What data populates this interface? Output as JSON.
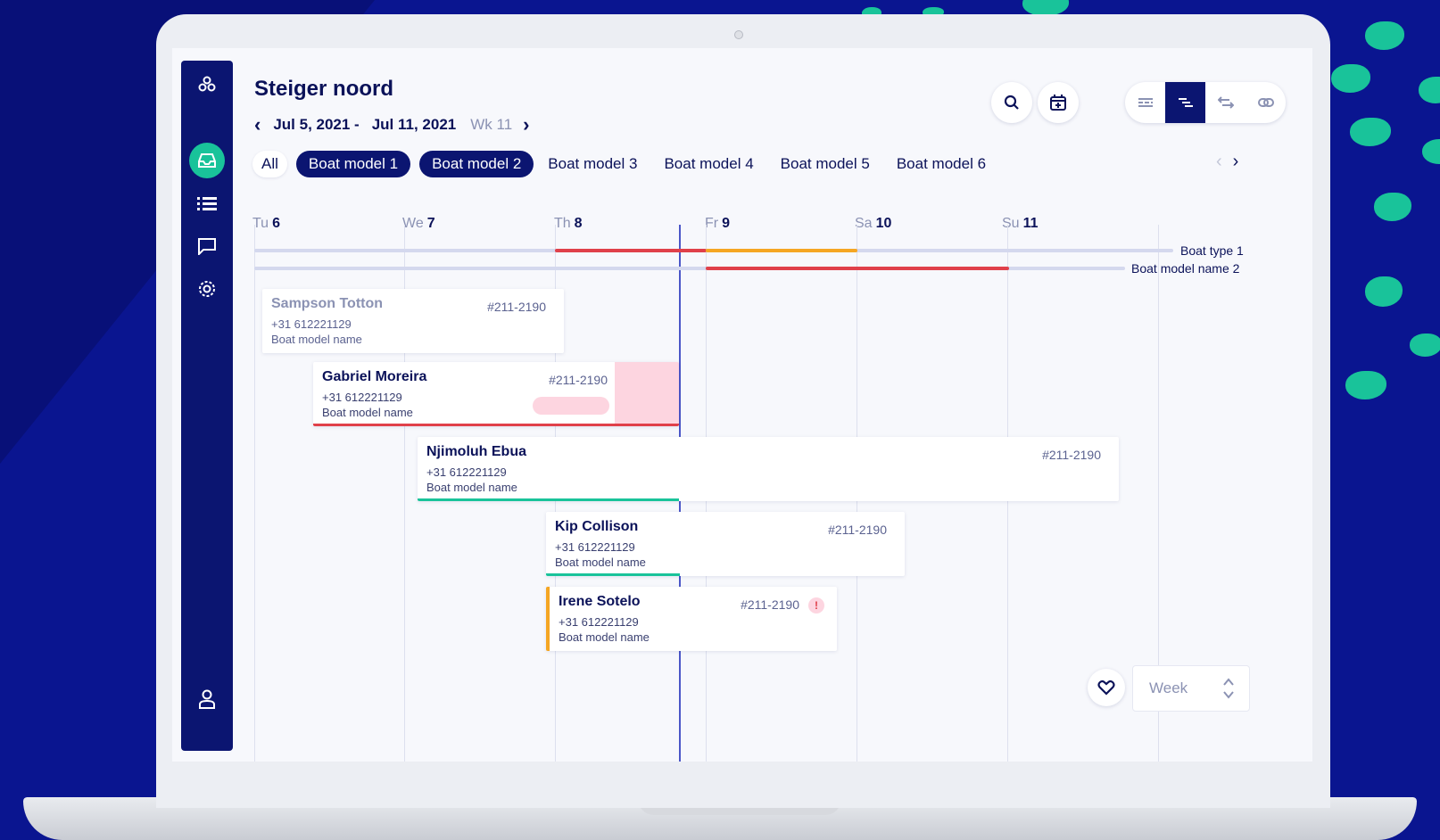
{
  "header": {
    "title": "Steiger noord",
    "date_start": "Jul 5, 2021 -",
    "date_end": "Jul 11, 2021",
    "week": "Wk 11"
  },
  "sidebar": {
    "items": [
      {
        "icon": "logo-icon"
      },
      {
        "icon": "inbox-icon",
        "active": true
      },
      {
        "icon": "list-icon"
      },
      {
        "icon": "chat-icon"
      },
      {
        "icon": "gear-icon"
      },
      {
        "icon": "user-icon"
      }
    ]
  },
  "toolbar": {
    "buttons": [
      "search-icon",
      "calendar-add-icon"
    ],
    "view_modes": [
      "filter-lines-icon",
      "gantt-icon",
      "swap-icon",
      "link-icon"
    ],
    "active_view": 1
  },
  "filters": {
    "all_label": "All",
    "models": [
      {
        "label": "Boat model 1",
        "selected": true
      },
      {
        "label": "Boat model 2",
        "selected": true
      },
      {
        "label": "Boat model 3",
        "selected": false
      },
      {
        "label": "Boat model 4",
        "selected": false
      },
      {
        "label": "Boat model 5",
        "selected": false
      },
      {
        "label": "Boat model 6",
        "selected": false
      }
    ]
  },
  "days": [
    {
      "abbr": "Tu",
      "num": "6"
    },
    {
      "abbr": "We",
      "num": "7"
    },
    {
      "abbr": "Th",
      "num": "8"
    },
    {
      "abbr": "Fr",
      "num": "9"
    },
    {
      "abbr": "Sa",
      "num": "10"
    },
    {
      "abbr": "Su",
      "num": "11"
    }
  ],
  "tracks": [
    {
      "label": "Boat type 1"
    },
    {
      "label": "Boat model name 2"
    }
  ],
  "bookings": [
    {
      "name": "Sampson Totton",
      "phone": "+31 612221129",
      "model": "Boat model name",
      "id": "#211-2190"
    },
    {
      "name": "Gabriel Moreira",
      "phone": "+31 612221129",
      "model": "Boat model name",
      "id": "#211-2190"
    },
    {
      "name": "Njimoluh Ebua",
      "phone": "+31 612221129",
      "model": "Boat model name",
      "id": "#211-2190"
    },
    {
      "name": "Kip Collison",
      "phone": "+31 612221129",
      "model": "Boat model name",
      "id": "#211-2190"
    },
    {
      "name": "Irene Sotelo",
      "phone": "+31 612221129",
      "model": "Boat model name",
      "id": "#211-2190",
      "alert": "!"
    }
  ],
  "footer": {
    "view_select": "Week"
  },
  "colors": {
    "navy": "#0b1571",
    "teal": "#19c39a",
    "red": "#e0404a",
    "orange": "#f5a623",
    "pink": "#fdd5e0"
  }
}
